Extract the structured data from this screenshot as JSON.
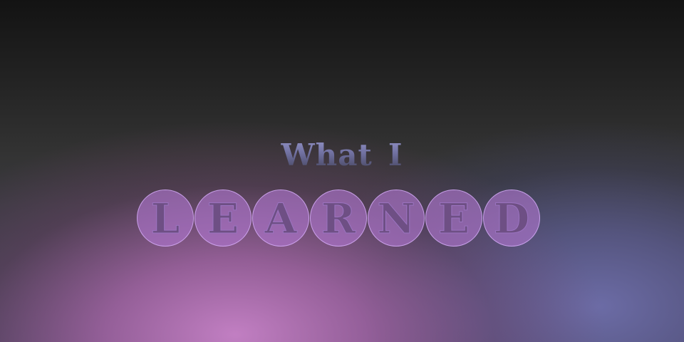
{
  "title": {
    "line1_words": [
      "What",
      "I"
    ],
    "line2_letters": [
      "L",
      "E",
      "A",
      "R",
      "N",
      "E",
      "D"
    ]
  },
  "colors": {
    "circle_fill": "#b278d2",
    "letter_color": "#6e4f84",
    "title_gradient_top": "#9a9ad0",
    "title_gradient_bottom": "#3b3b4e"
  }
}
